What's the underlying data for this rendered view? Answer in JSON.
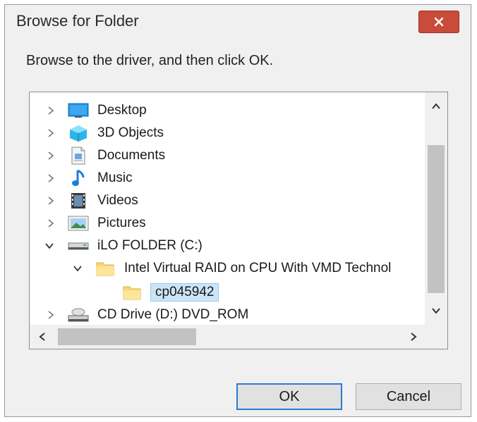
{
  "dialog": {
    "title": "Browse for Folder",
    "instruction": "Browse to the driver, and then click OK."
  },
  "tree": {
    "items": [
      {
        "label": "Desktop",
        "icon": "desktop-icon",
        "expanded": false,
        "level": 0
      },
      {
        "label": "3D Objects",
        "icon": "3d-objects-icon",
        "expanded": false,
        "level": 0
      },
      {
        "label": "Documents",
        "icon": "documents-icon",
        "expanded": false,
        "level": 0
      },
      {
        "label": "Music",
        "icon": "music-icon",
        "expanded": false,
        "level": 0
      },
      {
        "label": "Videos",
        "icon": "videos-icon",
        "expanded": false,
        "level": 0
      },
      {
        "label": "Pictures",
        "icon": "pictures-icon",
        "expanded": false,
        "level": 0
      },
      {
        "label": "iLO FOLDER (C:)",
        "icon": "drive-icon",
        "expanded": true,
        "level": 0
      },
      {
        "label": "Intel Virtual RAID on CPU With VMD Technol",
        "icon": "folder-icon",
        "expanded": true,
        "level": 1
      },
      {
        "label": "cp045942",
        "icon": "folder-icon",
        "expanded": false,
        "level": 2,
        "selected": true
      },
      {
        "label": "CD Drive (D:) DVD_ROM",
        "icon": "cd-drive-icon",
        "expanded": false,
        "level": 0
      }
    ]
  },
  "buttons": {
    "ok": "OK",
    "cancel": "Cancel"
  },
  "colors": {
    "close_button": "#c94b3a",
    "selection": "#cce4f7",
    "ok_border": "#2a7ad1"
  }
}
